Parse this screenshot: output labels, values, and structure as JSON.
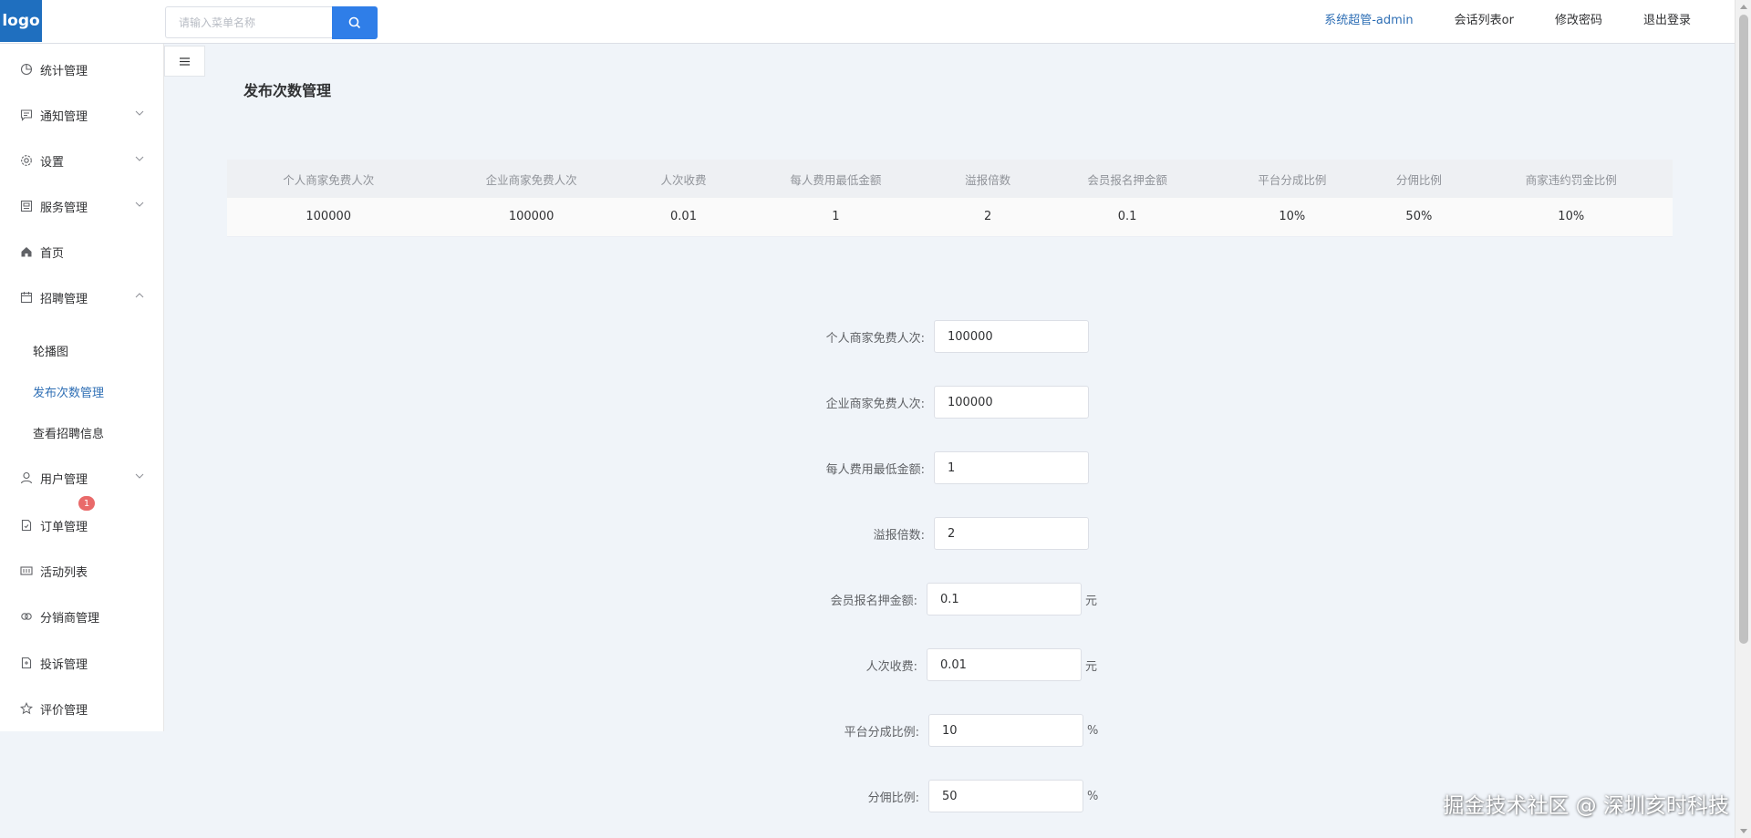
{
  "header": {
    "logo": "logo",
    "search_placeholder": "请输入菜单名称",
    "user": "系统超管-admin",
    "links": [
      "会话列表or",
      "修改密码",
      "退出登录"
    ]
  },
  "sidebar": {
    "items": [
      {
        "label": "统计管理",
        "icon": "pie-chart-icon",
        "has_chevron": false
      },
      {
        "label": "通知管理",
        "icon": "message-icon",
        "has_chevron": true
      },
      {
        "label": "设置",
        "icon": "gear-icon",
        "has_chevron": true
      },
      {
        "label": "服务管理",
        "icon": "service-icon",
        "has_chevron": true
      },
      {
        "label": "首页",
        "icon": "home-icon",
        "has_chevron": false
      },
      {
        "label": "招聘管理",
        "icon": "calendar-icon",
        "has_chevron": true,
        "expanded": true
      },
      {
        "label": "用户管理",
        "icon": "user-icon",
        "has_chevron": true
      },
      {
        "label": "订单管理",
        "icon": "document-icon",
        "has_chevron": false
      },
      {
        "label": "活动列表",
        "icon": "list-icon",
        "has_chevron": false
      },
      {
        "label": "分销商管理",
        "icon": "link-icon",
        "has_chevron": false
      },
      {
        "label": "投诉管理",
        "icon": "complaint-icon",
        "has_chevron": false
      },
      {
        "label": "评价管理",
        "icon": "star-icon",
        "has_chevron": false
      }
    ],
    "submenu": [
      "轮播图",
      "发布次数管理",
      "查看招聘信息"
    ],
    "active_sub": "发布次数管理",
    "badge": "1"
  },
  "page": {
    "title": "发布次数管理"
  },
  "table": {
    "headers": [
      "个人商家免费人次",
      "企业商家免费人次",
      "人次收费",
      "每人费用最低金额",
      "溢报倍数",
      "会员报名押金额",
      "平台分成比例",
      "分佣比例",
      "商家违约罚金比例"
    ],
    "rows": [
      [
        "100000",
        "100000",
        "0.01",
        "1",
        "2",
        "0.1",
        "10%",
        "50%",
        "10%"
      ]
    ]
  },
  "form": {
    "fields": [
      {
        "label": "个人商家免费人次:",
        "value": "100000",
        "unit": ""
      },
      {
        "label": "企业商家免费人次:",
        "value": "100000",
        "unit": ""
      },
      {
        "label": "每人费用最低金额:",
        "value": "1",
        "unit": ""
      },
      {
        "label": "溢报倍数:",
        "value": "2",
        "unit": ""
      },
      {
        "label": "会员报名押金额:",
        "value": "0.1",
        "unit": "元"
      },
      {
        "label": "人次收费:",
        "value": "0.01",
        "unit": "元"
      },
      {
        "label": "平台分成比例:",
        "value": "10",
        "unit": "%"
      },
      {
        "label": "分佣比例:",
        "value": "50",
        "unit": "%"
      }
    ]
  },
  "watermark": "掘金技术社区 @ 深圳亥时科技",
  "colors": {
    "primary": "#2f7ee8",
    "logo_bg": "#1f6fbf",
    "active_text": "#2f6fb5",
    "badge": "#e96a6a",
    "page_bg": "#f0f4f9"
  }
}
